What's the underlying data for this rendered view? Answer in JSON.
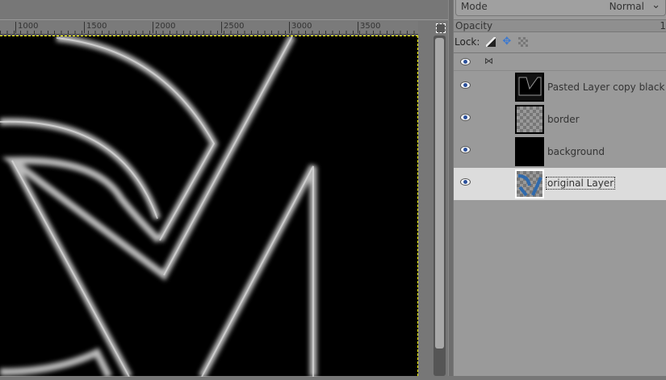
{
  "ruler": {
    "ticks": [
      "1000",
      "1500",
      "2000",
      "2500",
      "3000",
      "3500"
    ]
  },
  "panel": {
    "mode_label": "Mode",
    "mode_value": "Normal",
    "opacity_label": "Opacity",
    "opacity_value": "1",
    "lock_label": "Lock:"
  },
  "layers": [
    {
      "name": "Pasted Layer copy black",
      "visible": true,
      "selected": false
    },
    {
      "name": "border",
      "visible": true,
      "selected": false
    },
    {
      "name": "background",
      "visible": true,
      "selected": false
    },
    {
      "name": "original Layer",
      "visible": true,
      "selected": true
    }
  ],
  "colors": {
    "selection_border": "#ffff00",
    "canvas": "#000000",
    "selected_row": "#dcdcdc"
  }
}
